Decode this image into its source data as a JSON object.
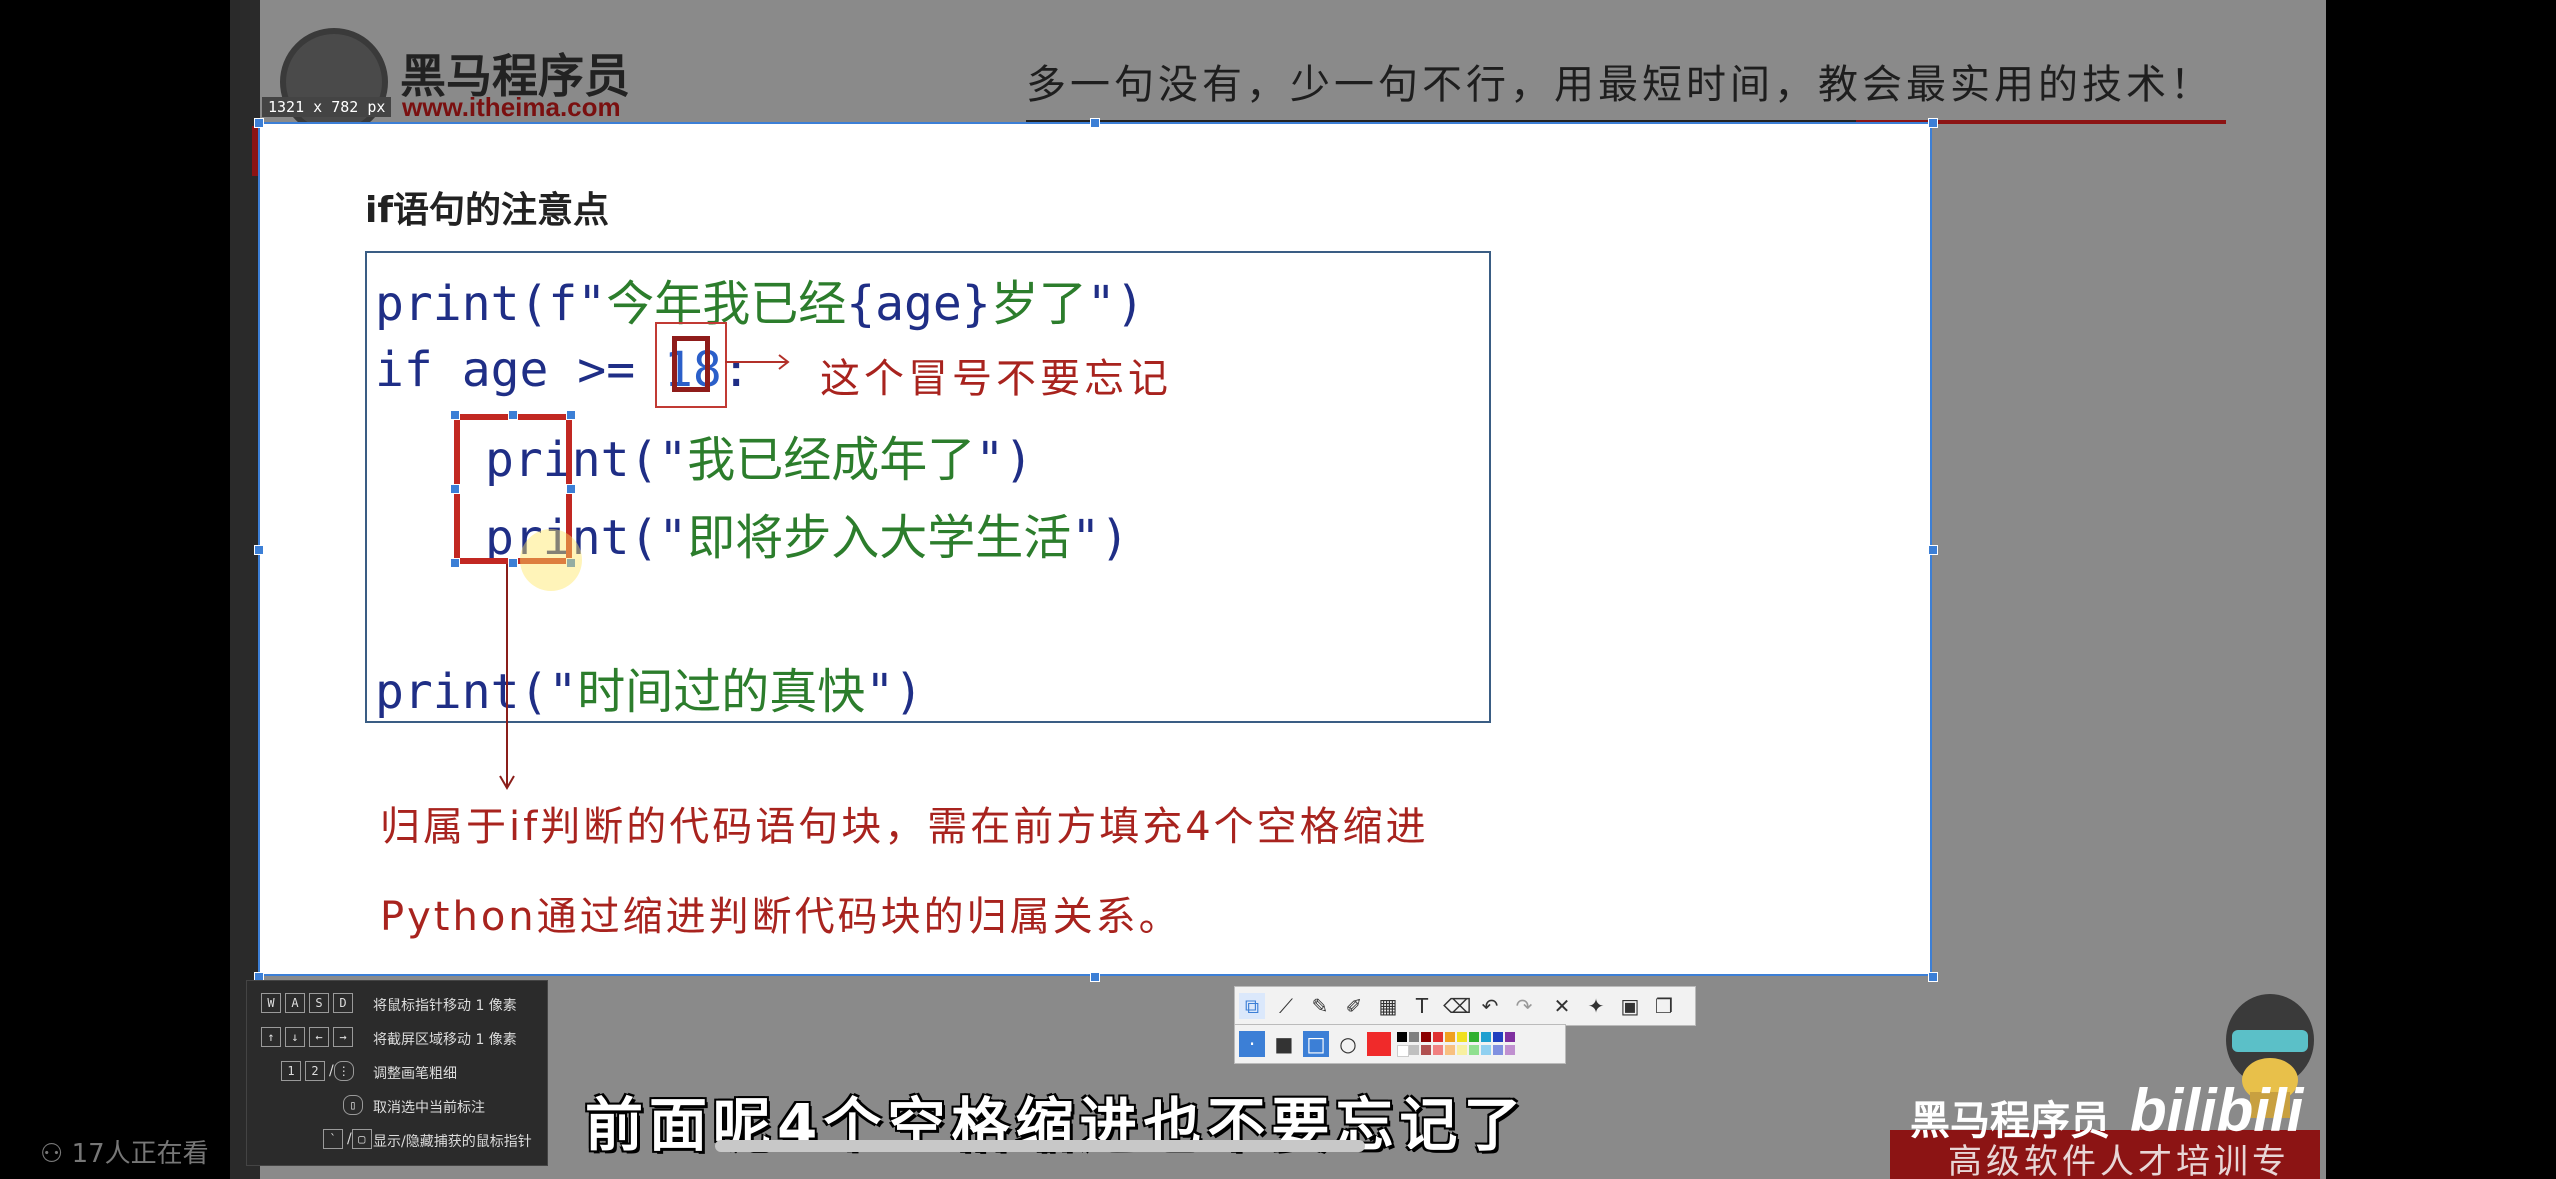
{
  "video": {
    "logo_name": "黑马程序员",
    "logo_url": "www.itheima.com",
    "slogan": "多一句没有，少一句不行，用最短时间，教会最实用的技术！",
    "capture_size": "1321 x 782  px"
  },
  "slide": {
    "title": "if语句的注意点",
    "code": {
      "line1": {
        "prefix": "print(f\"",
        "text": "今年我已经",
        "open": "{",
        "var": "age",
        "close": "}",
        "text2": "岁了",
        "suffix": "\")"
      },
      "line2": {
        "kw": "if",
        "expr": " age >= ",
        "num": "18",
        "colon": ":"
      },
      "line3": {
        "prefix": "print(\"",
        "text": "我已经成年了",
        "suffix": "\")"
      },
      "line4": {
        "prefix": "print(\"",
        "text": "即将步入大学生活",
        "suffix": "\")"
      },
      "line5": {
        "prefix": "print(\"",
        "text": "时间过的真快",
        "suffix": "\")"
      }
    },
    "annotation_colon": "这个冒号不要忘记",
    "annotation_block_1": "归属于if判断的代码语句块，需在前方填充4个空格缩进",
    "annotation_block_2": "Python通过缩进判断代码块的归属关系。"
  },
  "help_panel": {
    "rows": [
      {
        "keys": [
          "W",
          "A",
          "S",
          "D"
        ],
        "label": "将鼠标指针移动 1 像素"
      },
      {
        "keys": [
          "↑",
          "↓",
          "←",
          "→"
        ],
        "label": "将截屏区域移动 1 像素"
      },
      {
        "keys": [
          "1",
          "2",
          "/"
        ],
        "label": "调整画笔粗细"
      },
      {
        "keys": [],
        "label": "取消选中当前标注"
      },
      {
        "keys": [
          "`",
          "/"
        ],
        "label": "显示/隐藏捕获的鼠标指针"
      }
    ]
  },
  "toolbar": {
    "tools": [
      "select-icon",
      "line-icon",
      "pen-icon",
      "marker-icon",
      "mosaic-icon",
      "text-icon",
      "eraser-icon",
      "undo-icon",
      "redo-icon",
      "close-icon",
      "pin-icon",
      "save-icon",
      "copy-icon"
    ],
    "accent": "#3c7fd6",
    "pen_color": "#f02a2a"
  },
  "player": {
    "subtitle": "前面呢4个空格缩进也不要忘记了",
    "watch_count": "17人正在看",
    "brand": "黑马程序员",
    "bili": "bilibili",
    "brand_slogan": "高级软件人才培训专家"
  }
}
